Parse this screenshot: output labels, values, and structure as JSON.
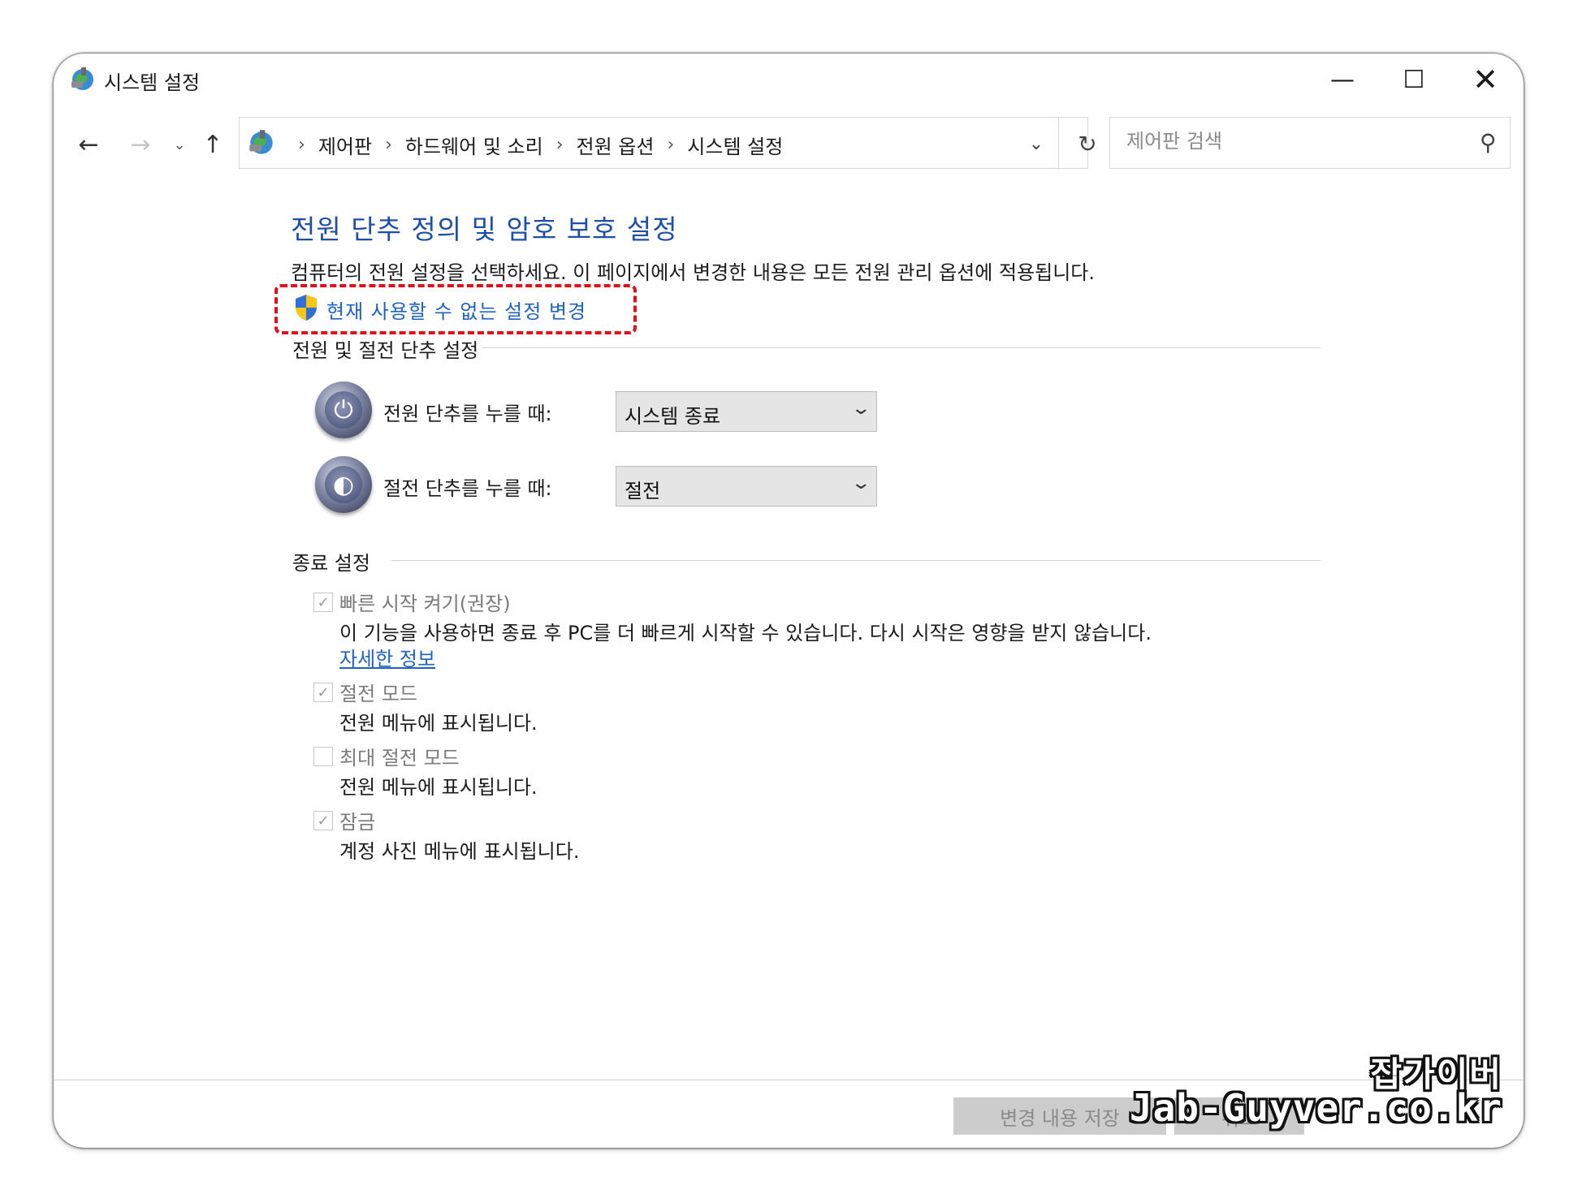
{
  "window": {
    "title": "시스템 설정",
    "controls": {
      "minimize": "—",
      "maximize": "☐",
      "close": "✕"
    }
  },
  "nav": {
    "back": "←",
    "forward": "→",
    "recent": "⌄",
    "up": "↑",
    "breadcrumbs": [
      "제어판",
      "하드웨어 및 소리",
      "전원 옵션",
      "시스템 설정"
    ],
    "separator": "›",
    "dropdown": "⌄",
    "refresh": "↻",
    "search_placeholder": "제어판 검색",
    "search_icon": "⚲"
  },
  "page": {
    "heading": "전원 단추 정의 및 암호 보호 설정",
    "description": "컴퓨터의 전원 설정을 선택하세요. 이 페이지에서 변경한 내용은 모든 전원 관리 옵션에 적용됩니다.",
    "change_unavailable_link": "현재 사용할 수 없는 설정 변경",
    "highlight_color": "#e1101b"
  },
  "power_section": {
    "heading": "전원 및 절전 단추 설정",
    "rows": [
      {
        "icon": "power-icon",
        "glyph": "⏻",
        "label": "전원 단추를 누를 때:",
        "value": "시스템 종료"
      },
      {
        "icon": "sleep-icon",
        "glyph": "◐",
        "label": "절전 단추를 누를 때:",
        "value": "절전"
      }
    ],
    "chevron": "⌄"
  },
  "shutdown_section": {
    "heading": "종료 설정",
    "options": [
      {
        "label": "빠른 시작 켜기(권장)",
        "checked": true,
        "description": "이 기능을 사용하면 종료 후 PC를 더 빠르게 시작할 수 있습니다. 다시 시작은 영향을 받지 않습니다.",
        "link": "자세한 정보"
      },
      {
        "label": "절전 모드",
        "checked": true,
        "description": "전원 메뉴에 표시됩니다."
      },
      {
        "label": "최대 절전 모드",
        "checked": false,
        "description": "전원 메뉴에 표시됩니다."
      },
      {
        "label": "잠금",
        "checked": true,
        "description": "계정 사진 메뉴에 표시됩니다."
      }
    ],
    "check_glyph": "✓"
  },
  "footer": {
    "save_button": "변경 내용 저장",
    "cancel_button": "취소"
  },
  "watermark": {
    "line1": "잡가이버",
    "line2": "Jab-Guyver.co.kr"
  },
  "colors": {
    "heading": "#1f4ea8",
    "link": "#1f62c4",
    "disabled_text": "#7a7a7a"
  }
}
